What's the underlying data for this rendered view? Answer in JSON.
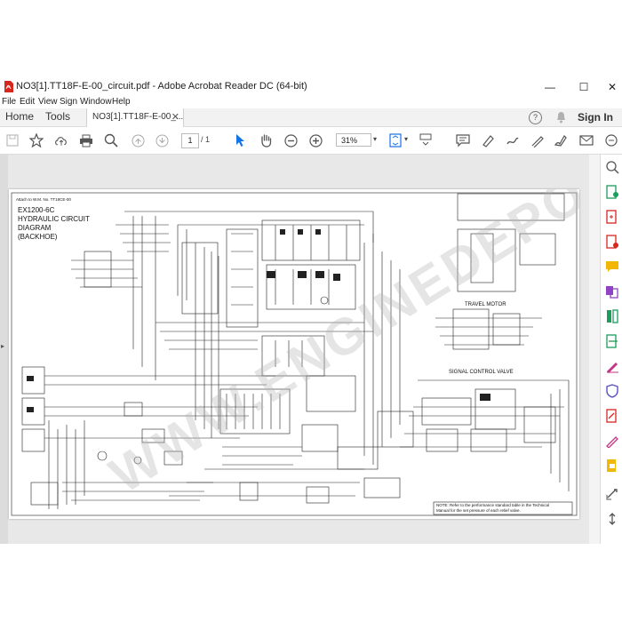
{
  "window": {
    "title": "NO3[1].TT18F-E-00_circuit.pdf - Adobe Acrobat Reader DC (64-bit)",
    "minimize": "—",
    "maximize": "☐",
    "close": "✕"
  },
  "menu": [
    "File",
    "Edit",
    "View",
    "Sign",
    "Window",
    "Help"
  ],
  "tabs": {
    "home": "Home",
    "tools": "Tools",
    "document": "NO3[1].TT18F-E-00_...",
    "close": "✕",
    "sign_in": "Sign In",
    "help": "?"
  },
  "toolbar": {
    "page_current": "1",
    "page_total": "/ 1",
    "zoom": "31%"
  },
  "diagram": {
    "ref_line": "Attach to W.M. No.   TT18CE-00",
    "model": "EX1200-6C",
    "title_line1": "HYDRAULIC CIRCUIT",
    "title_line2": "DIAGRAM",
    "title_line3": "(BACKHOE)",
    "travel_motor": "TRAVEL MOTOR",
    "signal_control_valve": "SIGNAL CONTROL VALVE",
    "note_line1": "NOTE: Refer to the performance standard table in the Technical",
    "note_line2": "Manual for the set pressure of each relief valve."
  },
  "watermark": "WWW.ENGINEDEPO.COM",
  "colors": {
    "accent": "#1473e6",
    "acrobat_red": "#d7261e",
    "tab_bg": "#f2f2f2",
    "doc_bg": "#e8e8e8"
  }
}
